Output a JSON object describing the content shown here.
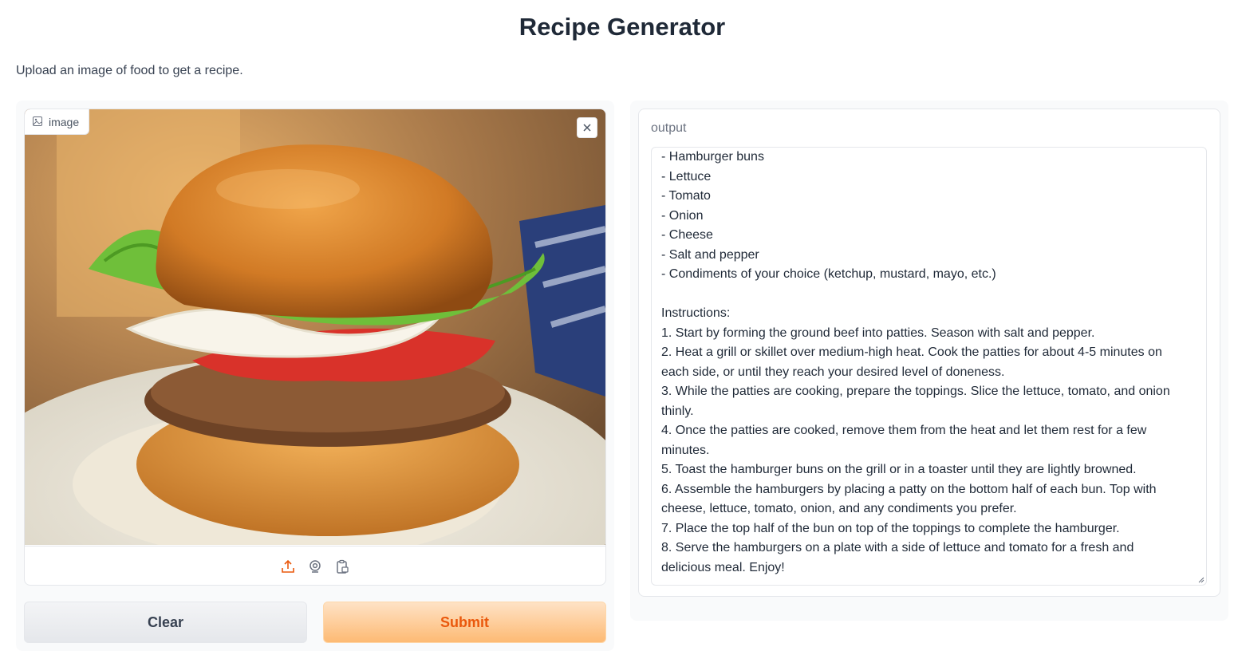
{
  "page": {
    "title": "Recipe Generator",
    "description": "Upload an image of food to get a recipe."
  },
  "image_input": {
    "label": "image",
    "close_icon": "close-icon",
    "label_icon": "image-icon",
    "sources": [
      "upload-icon",
      "webcam-icon",
      "clipboard-icon"
    ]
  },
  "buttons": {
    "clear_label": "Clear",
    "submit_label": "Submit"
  },
  "output": {
    "label": "output",
    "lines": [
      "- Hamburger buns",
      "- Lettuce",
      "- Tomato",
      "- Onion",
      "- Cheese",
      "- Salt and pepper",
      "- Condiments of your choice (ketchup, mustard, mayo, etc.)",
      "",
      "Instructions:",
      "1. Start by forming the ground beef into patties. Season with salt and pepper.",
      "2. Heat a grill or skillet over medium-high heat. Cook the patties for about 4-5 minutes on",
      "each side, or until they reach your desired level of doneness.",
      "3. While the patties are cooking, prepare the toppings. Slice the lettuce, tomato, and onion",
      "thinly.",
      "4. Once the patties are cooked, remove them from the heat and let them rest for a few",
      "minutes.",
      "5. Toast the hamburger buns on the grill or in a toaster until they are lightly browned.",
      "6. Assemble the hamburgers by placing a patty on the bottom half of each bun. Top with",
      "cheese, lettuce, tomato, onion, and any condiments you prefer.",
      "7. Place the top half of the bun on top of the toppings to complete the hamburger.",
      "8. Serve the hamburgers on a plate with a side of lettuce and tomato for a fresh and",
      "delicious meal. Enjoy!"
    ]
  },
  "colors": {
    "accent": "#ea580c",
    "submit_bg": "#fdba74",
    "clear_bg": "#e5e7eb"
  }
}
